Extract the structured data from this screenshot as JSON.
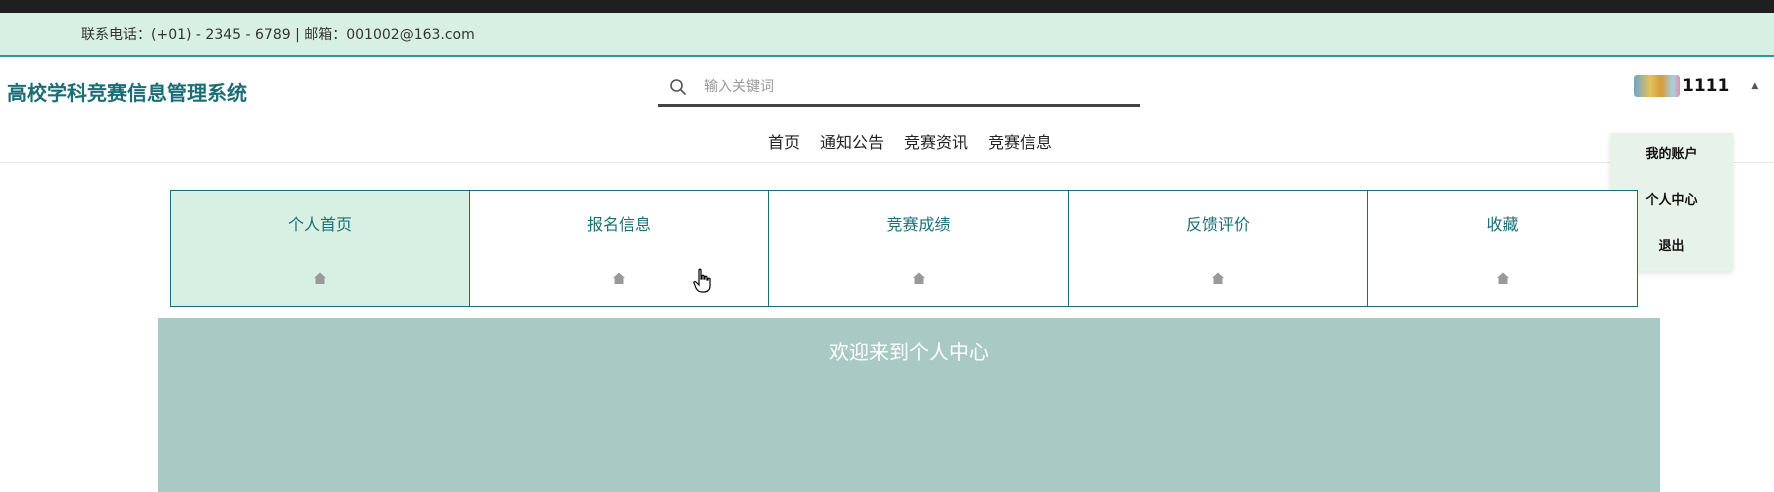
{
  "contact": {
    "text": "联系电话：(+01) - 2345 - 6789 | 邮箱：001002@163.com"
  },
  "header": {
    "title": "高校学科竞赛信息管理系统",
    "search_placeholder": "输入关键词"
  },
  "nav": {
    "items": [
      "首页",
      "通知公告",
      "竞赛资讯",
      "竞赛信息"
    ]
  },
  "user": {
    "name": "1111"
  },
  "dropdown": {
    "items": [
      "我的账户",
      "个人中心",
      "退出"
    ]
  },
  "tabs": [
    {
      "label": "个人首页",
      "active": true
    },
    {
      "label": "报名信息",
      "active": false
    },
    {
      "label": "竞赛成绩",
      "active": false
    },
    {
      "label": "反馈评价",
      "active": false
    },
    {
      "label": "收藏",
      "active": false
    }
  ],
  "welcome": {
    "text": "欢迎来到个人中心"
  },
  "colors": {
    "accent": "#1c6e76",
    "contact_bg": "#d8f0e3",
    "welcome_bg": "#a9c9c4"
  },
  "icons": {
    "search": "search-icon",
    "tab": "home-icon",
    "caret": "caret-up-icon"
  }
}
